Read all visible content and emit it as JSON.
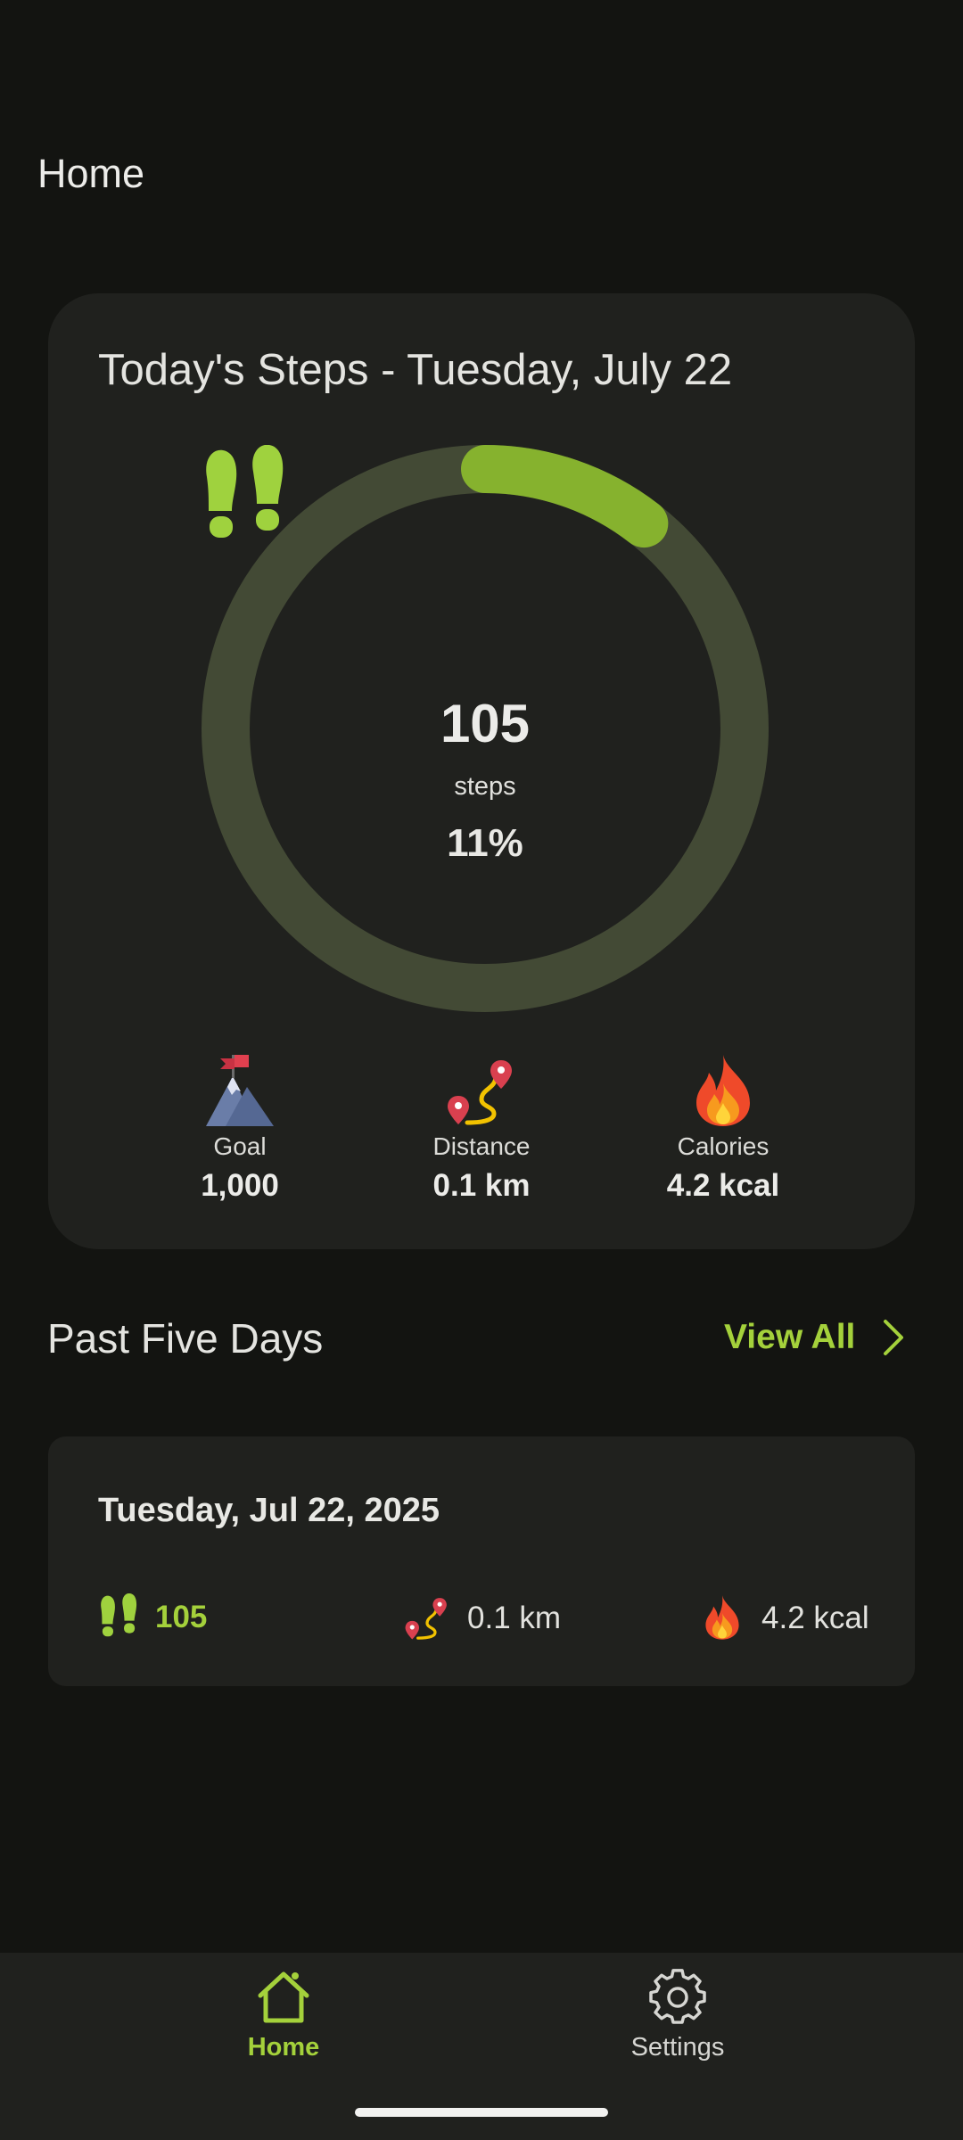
{
  "app_bar": {
    "title": "Home"
  },
  "today": {
    "title": "Today's Steps - Tuesday, July 22",
    "steps": "105",
    "steps_unit": "steps",
    "progress_percent_text": "11%",
    "progress_fraction": 0.105,
    "stats": {
      "goal": {
        "label": "Goal",
        "value": "1,000",
        "icon": "mountain-flag-icon"
      },
      "distance": {
        "label": "Distance",
        "value": "0.1 km",
        "icon": "route-pins-icon"
      },
      "calories": {
        "label": "Calories",
        "value": "4.2 kcal",
        "icon": "fire-icon"
      }
    }
  },
  "past_days": {
    "title": "Past Five Days",
    "view_all_label": "View All",
    "days": [
      {
        "date": "Tuesday, Jul 22, 2025",
        "steps": "105",
        "distance": "0.1 km",
        "calories": "4.2 kcal"
      }
    ]
  },
  "bottom_nav": {
    "items": [
      {
        "label": "Home",
        "icon": "home-icon",
        "active": true
      },
      {
        "label": "Settings",
        "icon": "gear-icon",
        "active": false
      }
    ]
  },
  "colors": {
    "background": "#131411",
    "card": "#20211e",
    "accent": "#a4d13b",
    "ring_track": "#434a35",
    "ring_progress": "#86b22e",
    "text": "#e6e6e3"
  }
}
